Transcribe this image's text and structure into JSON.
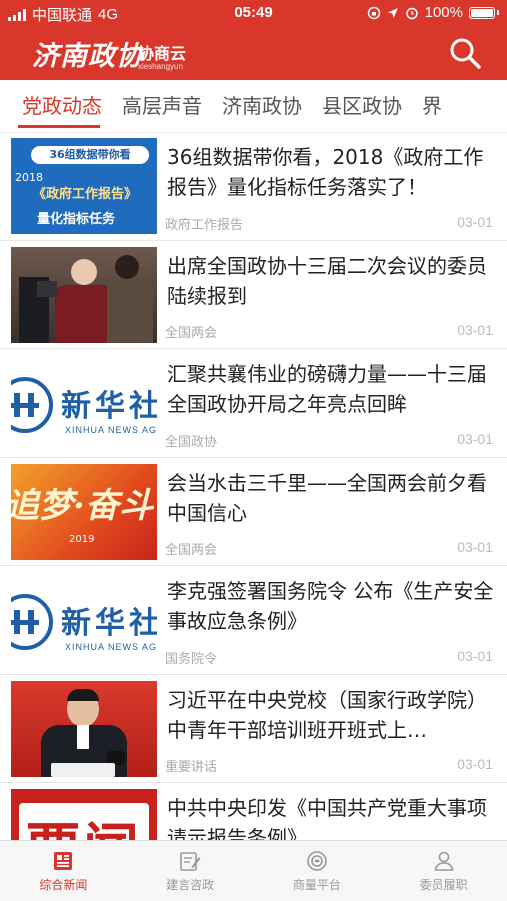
{
  "status_bar": {
    "carrier": "中国联通",
    "network": "4G",
    "time": "05:49",
    "battery": "100%"
  },
  "app_bar": {
    "logo_script": "济南政协",
    "brand_name": "协商云",
    "brand_pinyin": "xieshangyun"
  },
  "tabs": [
    {
      "label": "党政动态",
      "active": true
    },
    {
      "label": "高层声音"
    },
    {
      "label": "济南政协"
    },
    {
      "label": "县区政协"
    },
    {
      "label": "界"
    }
  ],
  "news": [
    {
      "title": "36组数据带你看，2018《政府工作报告》量化指标任务落实了！",
      "category": "政府工作报告",
      "date": "03-01",
      "thumb": {
        "kind": "report",
        "badge": "36组数据带你看",
        "year": "2018",
        "line1": "《政府工作报告》",
        "line2": "量化指标任务"
      }
    },
    {
      "title": "出席全国政协十三届二次会议的委员陆续报到",
      "category": "全国两会",
      "date": "03-01",
      "thumb": {
        "kind": "photo-interview"
      }
    },
    {
      "title": "汇聚共襄伟业的磅礴力量——十三届全国政协开局之年亮点回眸",
      "category": "全国政协",
      "date": "03-01",
      "thumb": {
        "kind": "xinhua",
        "cn": "新华社",
        "en": "XINHUA NEWS AGEN"
      }
    },
    {
      "title": "会当水击三千里——全国两会前夕看中国信心",
      "category": "全国两会",
      "date": "03-01",
      "thumb": {
        "kind": "poster",
        "text": "追梦·奋斗",
        "year": "2019"
      }
    },
    {
      "title": "李克强签署国务院令 公布《生产安全事故应急条例》",
      "category": "国务院令",
      "date": "03-01",
      "thumb": {
        "kind": "xinhua",
        "cn": "新华社",
        "en": "XINHUA NEWS AGEN"
      }
    },
    {
      "title": "习近平在中央党校（国家行政学院）中青年干部培训班开班式上…",
      "category": "重要讲话",
      "date": "03-01",
      "thumb": {
        "kind": "photo-speech"
      }
    },
    {
      "title": "中共中央印发《中国共产党重大事项请示报告条例》",
      "category": "",
      "date": "",
      "thumb": {
        "kind": "banner",
        "text": "要闻"
      }
    }
  ],
  "bottom_nav": [
    {
      "label": "综合新闻",
      "icon": "newspaper-icon",
      "active": true
    },
    {
      "label": "建言咨政",
      "icon": "edit-note-icon"
    },
    {
      "label": "商量平台",
      "icon": "chat-circle-icon"
    },
    {
      "label": "委员履职",
      "icon": "person-icon"
    }
  ],
  "colors": {
    "brand_red": "#d9372b",
    "inactive": "#999999"
  }
}
